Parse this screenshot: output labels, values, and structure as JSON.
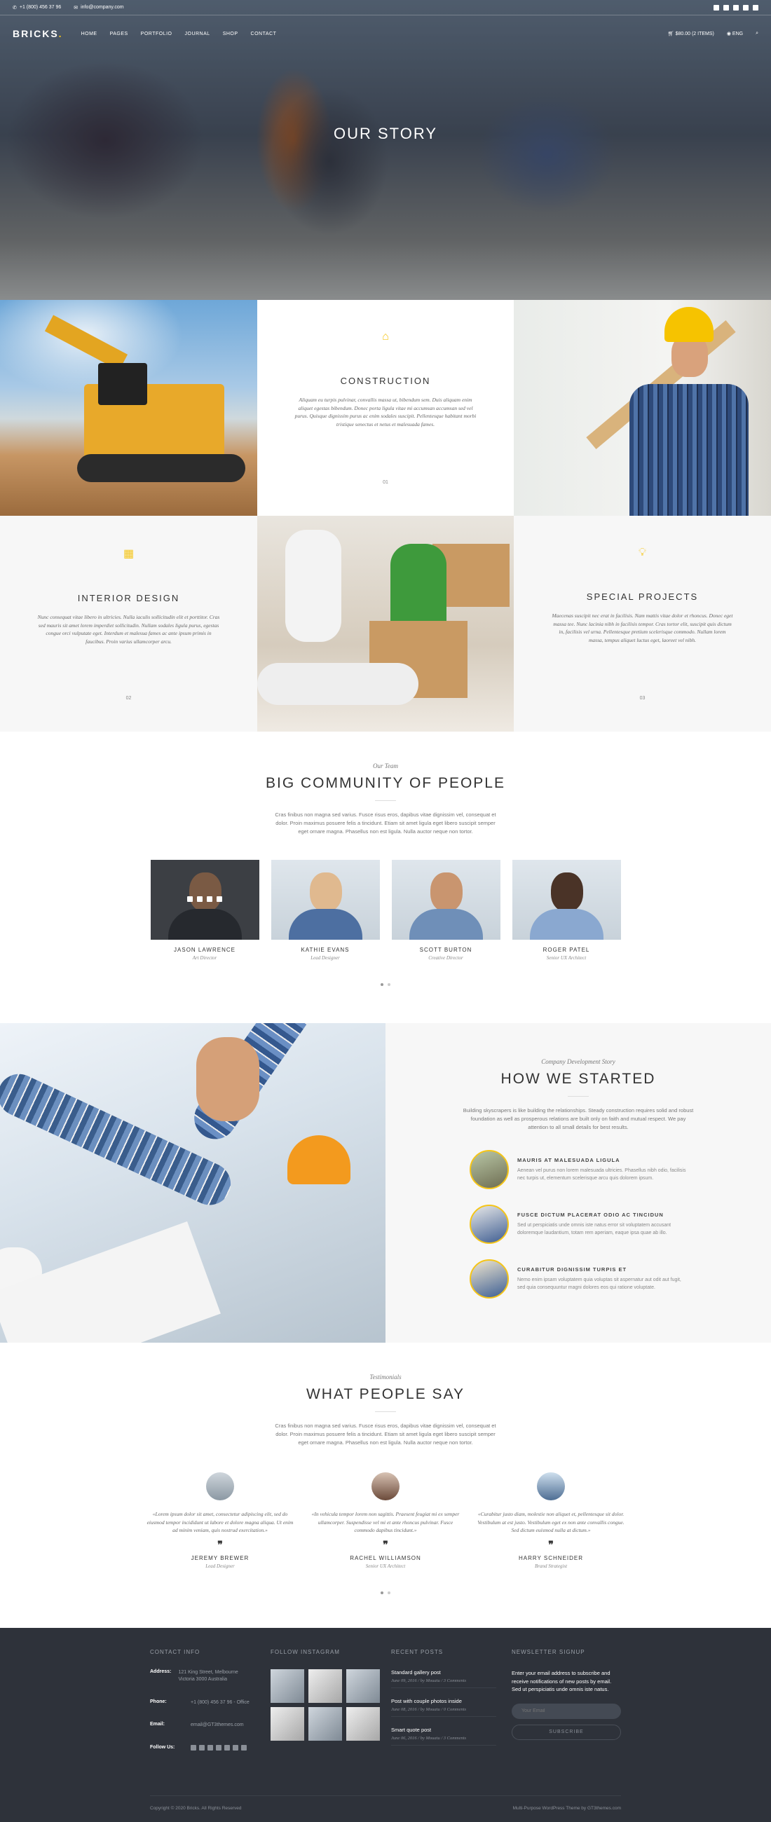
{
  "topbar": {
    "phone": "+1 (800) 456 37 96",
    "email": "info@company.com"
  },
  "nav": {
    "logo": "BRICKS",
    "logo_dot": ".",
    "menu": [
      "HOME",
      "PAGES",
      "PORTFOLIO",
      "JOURNAL",
      "SHOP",
      "CONTACT"
    ],
    "cart": "$80.00 (2 ITEMS)",
    "lang": "ENG"
  },
  "hero": {
    "title": "OUR STORY"
  },
  "services": [
    {
      "title": "CONSTRUCTION",
      "text": "Aliquam eu turpis pulvinar, convallis massa ut, bibendum sem. Duis aliquam enim aliquet egestas bibendum. Donec porta ligula vitae mi accumsan accumsan sed vel purus. Quisque dignissim purus ac enim sodales suscipit. Pellentesque habitant morbi tristique senectus et netus et malesuada fames.",
      "num": "01"
    },
    {
      "title": "INTERIOR DESIGN",
      "text": "Nunc consequat vitae libero in ultricies. Nulla iaculis sollicitudin elit et porttitor. Cras sed mauris sit amet lorem imperdiet sollicitudin. Nullam sodales ligula purus, egestas congue orci vulputate eget. Interdum et malesua fames ac ante ipsum primis in faucibus. Proin varius ullamcorper arcu.",
      "num": "02"
    },
    {
      "title": "SPECIAL PROJECTS",
      "text": "Maecenas suscipit nec erat in facilisis. Nam mattis vitae dolor et rhoncus. Donec eget massa tee. Nunc lacinia nibh in facilisis tempor. Cras tortor elit, suscipit quis dictum in, facilisis vel urna. Pellentesque pretium scelerisque commodo. Nullam lorem massa, tempus aliquet luctus eget, laoreet vel nibh.",
      "num": "03"
    }
  ],
  "team": {
    "kicker": "Our Team",
    "title": "BIG COMMUNITY OF PEOPLE",
    "intro": "Cras finibus non magna sed varius. Fusce risus eros, dapibus vitae dignissim vel, consequat et dolor. Proin maximus posuere felis a tincidunt. Etiam sit amet ligula eget libero suscipit semper eget ornare magna. Phasellus non est ligula. Nulla auctor neque non tortor.",
    "members": [
      {
        "name": "JASON LAWRENCE",
        "role": "Art Director"
      },
      {
        "name": "KATHIE EVANS",
        "role": "Lead Designer"
      },
      {
        "name": "SCOTT BURTON",
        "role": "Creative Director"
      },
      {
        "name": "ROGER PATEL",
        "role": "Senior UX Architect"
      }
    ]
  },
  "story": {
    "kicker": "Company Development Story",
    "title": "HOW WE STARTED",
    "intro": "Building skyscrapers is like building the relationships. Steady construction requires solid and robust foundation as well as prosperous relations are built only on faith and mutual respect. We pay attention to all small details for best results.",
    "steps": [
      {
        "title": "MAURIS AT MALESUADA LIGULA",
        "text": "Aenean vel purus non lorem malesuada ultricies. Phasellus nibh odio, facilisis nec turpis ut, elementum scelerisque arcu quis dolorem ipsum."
      },
      {
        "title": "FUSCE DICTUM PLACERAT ODIO AC TINCIDUN",
        "text": "Sed ut perspiciatis unde omnis iste natus error sit voluptatem accusant doloremque laudantium, totam rem aperiam, eaque ipsa quae ab illo."
      },
      {
        "title": "CURABITUR DIGNISSIM TURPIS ET",
        "text": "Nemo enim ipsam voluptatem quia voluptas sit aspernatur aut odit aut fugit, sed quia consequuntur magni dolores eos qui ratione voluptate."
      }
    ]
  },
  "testimonials": {
    "kicker": "Testimonials",
    "title": "WHAT PEOPLE SAY",
    "intro": "Cras finibus non magna sed varius. Fusce risus eros, dapibus vitae dignissim vel, consequat et dolor. Proin maximus posuere felis a tincidunt. Etiam sit amet ligula eget libero suscipit semper eget ornare magna. Phasellus non est ligula. Nulla auctor neque non tortor.",
    "items": [
      {
        "quote": "«Lorem ipsum dolor sit amet, consectetur adipiscing elit, sed do eiusmod tempor incididunt ut labore et dolore magna aliqua. Ut enim ad minim veniam, quis nostrud exercitation.»",
        "name": "JEREMY BREWER",
        "role": "Lead Designer"
      },
      {
        "quote": "«In vehicula tempor lorem non sagittis. Praesent feugiat mi ex semper ullamcorper. Suspendisse vel mi et ante rhoncus pulvinar. Fusce commodo dapibus tincidunt.»",
        "name": "RACHEL WILLIAMSON",
        "role": "Senior UX Architect"
      },
      {
        "quote": "«Curabitur justo diam, molestie non aliquet et, pellentesque sit dolor. Vestibulum at est justo. Vestibulum eget ex non ante convallis congue. Sed dictum euismod nulla at dictum.»",
        "name": "HARRY SCHNEIDER",
        "role": "Brand Strategist"
      }
    ]
  },
  "footer": {
    "contact": {
      "heading": "CONTACT INFO",
      "address_label": "Address:",
      "address": "121 King Street, Melbourne Victoria 3000 Australia",
      "phone_label": "Phone:",
      "phone": "+1 (800) 456 37 96 - Office",
      "email_label": "Email:",
      "email": "email@GT3themes.com",
      "follow_label": "Follow Us:"
    },
    "instagram": {
      "heading": "FOLLOW INSTAGRAM"
    },
    "posts": {
      "heading": "RECENT POSTS",
      "items": [
        {
          "title": "Standard gallery post",
          "date": "June 09, 2016",
          "author": "by Mouatu",
          "comments": "3 Comments"
        },
        {
          "title": "Post with couple photos inside",
          "date": "June 08, 2016",
          "author": "by Mouatu",
          "comments": "0 Comments"
        },
        {
          "title": "Smart quote post",
          "date": "June 06, 2016",
          "author": "by Mouatu",
          "comments": "3 Comments"
        }
      ]
    },
    "newsletter": {
      "heading": "NEWSLETTER SIGNUP",
      "text": "Enter your email address to subscribe and receive notifications of new posts by email. Sed ut perspiciatis unde omnis iste natus.",
      "placeholder": "Your Email",
      "button": "SUBSCRIBE"
    },
    "copyright": "Copyright © 2020 Bricks. All Rights Reserved",
    "credit": "Multi-Purpose WordPress Theme by GT3themes.com"
  }
}
